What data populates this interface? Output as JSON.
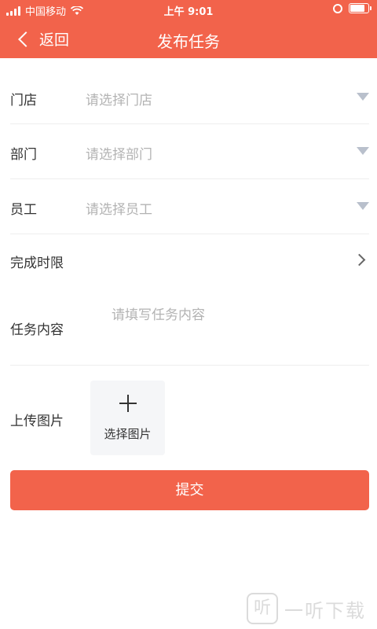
{
  "status_bar": {
    "carrier": "中国移动",
    "time": "上午 9:01",
    "battery_level": 0.85
  },
  "nav": {
    "back_label": "返回",
    "title": "发布任务"
  },
  "form": {
    "store": {
      "label": "门店",
      "placeholder": "请选择门店"
    },
    "department": {
      "label": "部门",
      "placeholder": "请选择部门"
    },
    "employee": {
      "label": "员工",
      "placeholder": "请选择员工"
    },
    "deadline": {
      "label": "完成时限"
    },
    "content": {
      "label": "任务内容",
      "placeholder": "请填写任务内容"
    },
    "upload": {
      "label": "上传图片",
      "button_label": "选择图片"
    }
  },
  "submit_label": "提交",
  "watermark": {
    "logo": "听",
    "text": "一听下载"
  },
  "colors": {
    "brand": "#f2634b",
    "placeholder": "#b3b3b3",
    "dropdown_icon": "#b9c0cc"
  },
  "icons": [
    "signal-icon",
    "wifi-icon",
    "lock-rotation-icon",
    "battery-icon",
    "back-chevron-icon",
    "dropdown-triangle-icon",
    "chevron-right-icon",
    "plus-icon"
  ]
}
